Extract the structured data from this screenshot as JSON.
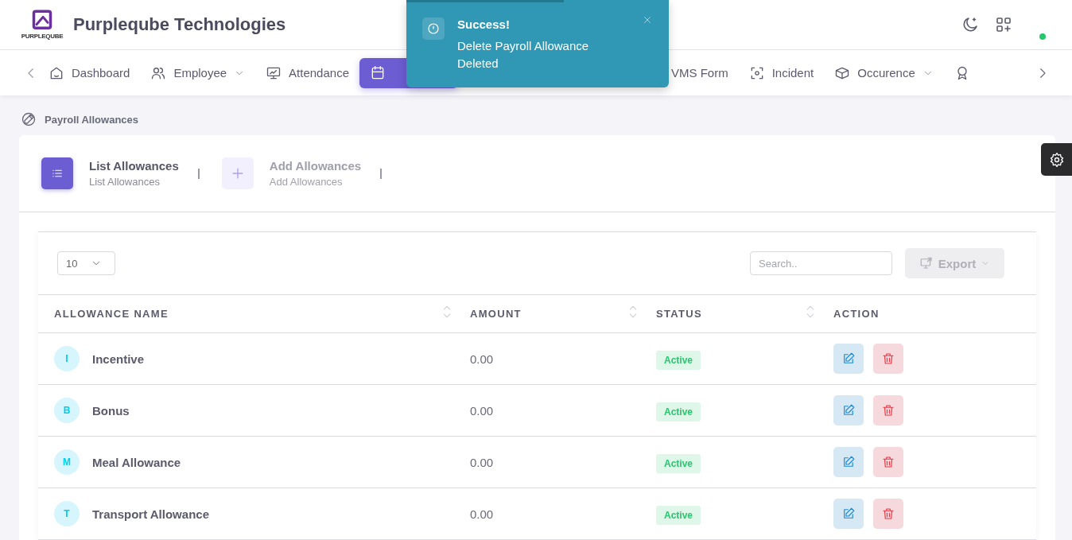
{
  "header": {
    "logo_text": "PURPLEQUBE",
    "company": "Purpleqube Technologies",
    "online": true
  },
  "nav": {
    "items": [
      {
        "label": "Dashboard",
        "dropdown": false,
        "selected": false
      },
      {
        "label": "Employee",
        "dropdown": true,
        "selected": false
      },
      {
        "label": "Attendance",
        "dropdown": false,
        "selected": false
      },
      {
        "dropdown": false,
        "selected": true
      },
      {
        "label": "VMS Form",
        "dropdown": false,
        "selected": false
      },
      {
        "label": "Incident",
        "dropdown": false,
        "selected": false
      },
      {
        "label": "Occurence",
        "dropdown": true,
        "selected": false
      },
      {
        "dropdown": false,
        "selected": false
      }
    ]
  },
  "toast": {
    "title": "Success!",
    "message": "Delete Payroll Allowance Deleted",
    "level": 0.6
  },
  "breadcrumb": "Payroll Allowances",
  "steps": [
    {
      "title": "List Allowances",
      "subtitle": "List Allowances",
      "selected": true
    },
    {
      "title": "Add Allowances",
      "subtitle": "Add Allowances",
      "selected": false
    }
  ],
  "table": {
    "page_size": "10",
    "search_placeholder": "Search..",
    "export": "Export",
    "columns": [
      {
        "label": "ALLOWANCE NAME"
      },
      {
        "label": "AMOUNT"
      },
      {
        "label": "STATUS"
      },
      {
        "label": "ACTION"
      }
    ],
    "rows": [
      {
        "initial": "I",
        "name": "Incentive",
        "amount": "0.00",
        "status": "Active"
      },
      {
        "initial": "B",
        "name": "Bonus",
        "amount": "0.00",
        "status": "Active"
      },
      {
        "initial": "M",
        "name": "Meal Allowance",
        "amount": "0.00",
        "status": "Active"
      },
      {
        "initial": "T",
        "name": "Transport Allowance",
        "amount": "0.00",
        "status": "Active"
      }
    ]
  }
}
